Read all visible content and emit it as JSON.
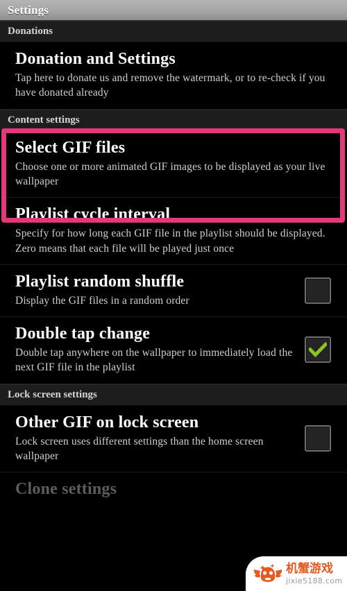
{
  "window": {
    "title": "Settings"
  },
  "colors": {
    "highlight_pink": "#e03a7c",
    "checkbox_check_green": "#8cc428",
    "titlebar_gray": "#a9a9a9",
    "background": "#000000",
    "watermark_orange": "#e8591f"
  },
  "sections": [
    {
      "header": "Donations",
      "items": [
        {
          "title": "Donation and Settings",
          "summary": "Tap here to donate us and remove the watermark, or to re-check if you have donated already",
          "widget": "none"
        }
      ]
    },
    {
      "header": "Content settings",
      "items": [
        {
          "title": "Select GIF files",
          "summary": "Choose one or more animated GIF images to be displayed as your live wallpaper",
          "widget": "none",
          "highlighted": true
        },
        {
          "title": "Playlist cycle interval",
          "summary": "Specify for how long each GIF file in the playlist should be displayed. Zero means that each file will be played just once",
          "widget": "none"
        },
        {
          "title": "Playlist random shuffle",
          "summary": "Display the GIF files in a random order",
          "widget": "checkbox",
          "checked": false
        },
        {
          "title": "Double tap change",
          "summary": "Double tap anywhere on the wallpaper to immediately load the next GIF file in the playlist",
          "widget": "checkbox",
          "checked": true
        }
      ]
    },
    {
      "header": "Lock screen settings",
      "items": [
        {
          "title": "Other GIF on lock screen",
          "summary": "Lock screen uses different settings than the home screen wallpaper",
          "widget": "checkbox",
          "checked": false
        },
        {
          "title": "Clone settings",
          "summary": "",
          "widget": "none",
          "disabled": true
        }
      ]
    }
  ],
  "watermark": {
    "brand_cn": "机蟹游戏",
    "url": "jixie5188.com"
  }
}
